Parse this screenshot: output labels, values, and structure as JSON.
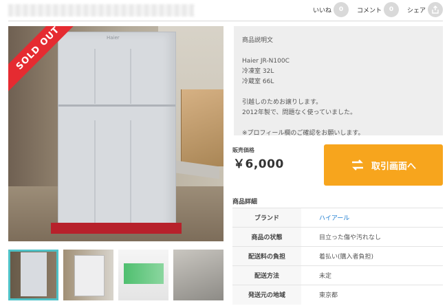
{
  "social": {
    "like_label": "いいね",
    "like_count": "0",
    "comment_label": "コメント",
    "comment_count": "0",
    "share_label": "シェア"
  },
  "photo": {
    "badge": "SOLD OUT",
    "brand_mark": "Haier"
  },
  "description": {
    "title": "商品説明文",
    "body": "Haier JR-N100C\n冷凍室 32L\n冷蔵室 66L\n\n引越しのためお譲りします。\n2012年製で、問題なく使っていました。\n\n※プロフィール欄のご確認をお願いします。"
  },
  "price": {
    "label": "販売価格",
    "value": "￥6,000"
  },
  "trade_button": {
    "label": "取引画面へ"
  },
  "details": {
    "title": "商品詳細",
    "rows": [
      {
        "key": "ブランド",
        "value": "ハイアール"
      },
      {
        "key": "商品の状態",
        "value": "目立った傷や汚れなし"
      },
      {
        "key": "配送料の負担",
        "value": "着払い(購入者負担)"
      },
      {
        "key": "配送方法",
        "value": "未定"
      },
      {
        "key": "発送元の地域",
        "value": "東京都"
      }
    ]
  },
  "colors": {
    "accent": "#f7a51d",
    "sold_out": "#e52b31",
    "link": "#1a7bd0",
    "thumb_active": "#4ec2c7"
  }
}
